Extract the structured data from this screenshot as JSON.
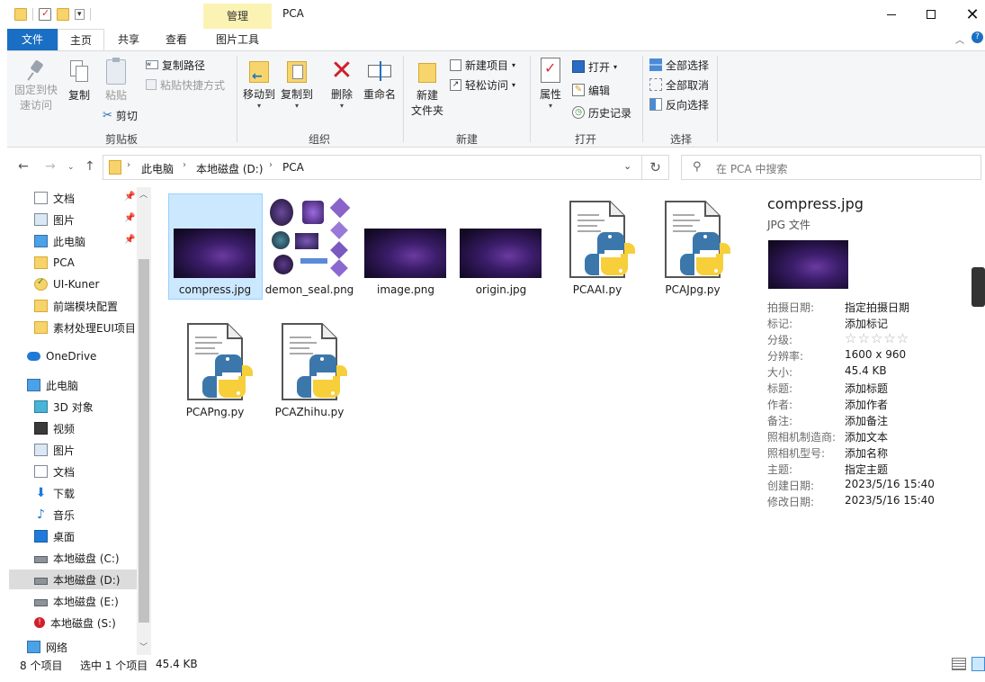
{
  "window": {
    "title": "PCA",
    "context_tab_group": "管理",
    "minimize_icon": "minimize-icon",
    "maximize_icon": "maximize-icon",
    "close_icon": "close-icon"
  },
  "tabs": [
    {
      "label": "文件",
      "active": false
    },
    {
      "label": "主页",
      "active": true
    },
    {
      "label": "共享",
      "active": false
    },
    {
      "label": "查看",
      "active": false
    },
    {
      "label": "图片工具",
      "active": false
    }
  ],
  "ribbon": {
    "clipboard": {
      "label": "剪贴板",
      "pin_quick_access": [
        "固定到快",
        "速访问"
      ],
      "copy": "复制",
      "paste": "粘贴",
      "copy_path": "复制路径",
      "paste_shortcut": "粘贴快捷方式",
      "cut": "剪切"
    },
    "organize": {
      "label": "组织",
      "move_to": "移动到",
      "copy_to": "复制到",
      "delete": "删除",
      "rename": "重命名"
    },
    "new": {
      "label": "新建",
      "new_folder": [
        "新建",
        "文件夹"
      ],
      "new_item": "新建项目",
      "easy_access": "轻松访问"
    },
    "open": {
      "label": "打开",
      "properties": "属性",
      "open": "打开",
      "edit": "编辑",
      "history": "历史记录"
    },
    "select": {
      "label": "选择",
      "select_all": "全部选择",
      "select_none": "全部取消",
      "invert": "反向选择"
    }
  },
  "address": {
    "breadcrumb": [
      "此电脑",
      "本地磁盘 (D:)",
      "PCA"
    ],
    "search_placeholder": "在 PCA 中搜索"
  },
  "nav_pane": {
    "quick_access": [
      {
        "label": "文档",
        "icon": "documents-icon",
        "pinned": true
      },
      {
        "label": "图片",
        "icon": "pictures-icon",
        "pinned": true
      },
      {
        "label": "此电脑",
        "icon": "computer-icon",
        "pinned": true
      },
      {
        "label": "PCA",
        "icon": "folder-icon",
        "pinned": false
      },
      {
        "label": "UI-Kuner",
        "icon": "folder-check-icon",
        "pinned": false
      },
      {
        "label": "前端模块配置",
        "icon": "folder-icon",
        "pinned": false
      },
      {
        "label": "素材处理EUI项目",
        "icon": "folder-icon",
        "pinned": false
      }
    ],
    "onedrive": "OneDrive",
    "this_pc": "此电脑",
    "pc_items": [
      {
        "label": "3D 对象",
        "icon": "cube-icon"
      },
      {
        "label": "视频",
        "icon": "video-icon"
      },
      {
        "label": "图片",
        "icon": "pictures-icon"
      },
      {
        "label": "文档",
        "icon": "documents-icon"
      },
      {
        "label": "下载",
        "icon": "download-icon"
      },
      {
        "label": "音乐",
        "icon": "music-icon"
      },
      {
        "label": "桌面",
        "icon": "desktop-icon"
      },
      {
        "label": "本地磁盘 (C:)",
        "icon": "drive-icon"
      },
      {
        "label": "本地磁盘 (D:)",
        "icon": "drive-icon",
        "selected": true
      },
      {
        "label": "本地磁盘 (E:)",
        "icon": "drive-icon"
      },
      {
        "label": "本地磁盘 (S:)",
        "icon": "drive-warning-icon"
      }
    ],
    "network": "网络"
  },
  "files": [
    {
      "name": "compress.jpg",
      "type": "image",
      "selected": true
    },
    {
      "name": "demon_seal.png",
      "type": "sprites",
      "selected": false
    },
    {
      "name": "image.png",
      "type": "image",
      "selected": false
    },
    {
      "name": "origin.jpg",
      "type": "image",
      "selected": false
    },
    {
      "name": "PCAAI.py",
      "type": "python",
      "selected": false
    },
    {
      "name": "PCAJpg.py",
      "type": "python",
      "selected": false
    },
    {
      "name": "PCAPng.py",
      "type": "python",
      "selected": false
    },
    {
      "name": "PCAZhihu.py",
      "type": "python",
      "selected": false
    }
  ],
  "details": {
    "filename": "compress.jpg",
    "filetype": "JPG 文件",
    "props": [
      {
        "key": "拍摄日期:",
        "value": "指定拍摄日期"
      },
      {
        "key": "标记:",
        "value": "添加标记"
      },
      {
        "key": "分级:",
        "value": "☆☆☆☆☆"
      },
      {
        "key": "分辨率:",
        "value": "1600 x 960"
      },
      {
        "key": "大小:",
        "value": "45.4 KB"
      },
      {
        "key": "标题:",
        "value": "添加标题"
      },
      {
        "key": "作者:",
        "value": "添加作者"
      },
      {
        "key": "备注:",
        "value": "添加备注"
      },
      {
        "key": "照相机制造商:",
        "value": "添加文本"
      },
      {
        "key": "照相机型号:",
        "value": "添加名称"
      },
      {
        "key": "主题:",
        "value": "指定主题"
      },
      {
        "key": "创建日期:",
        "value": "2023/5/16 15:40"
      },
      {
        "key": "修改日期:",
        "value": "2023/5/16 15:40"
      }
    ]
  },
  "status": {
    "item_count": "8 个项目",
    "selected": "选中 1 个项目",
    "size": "45.4 KB"
  }
}
